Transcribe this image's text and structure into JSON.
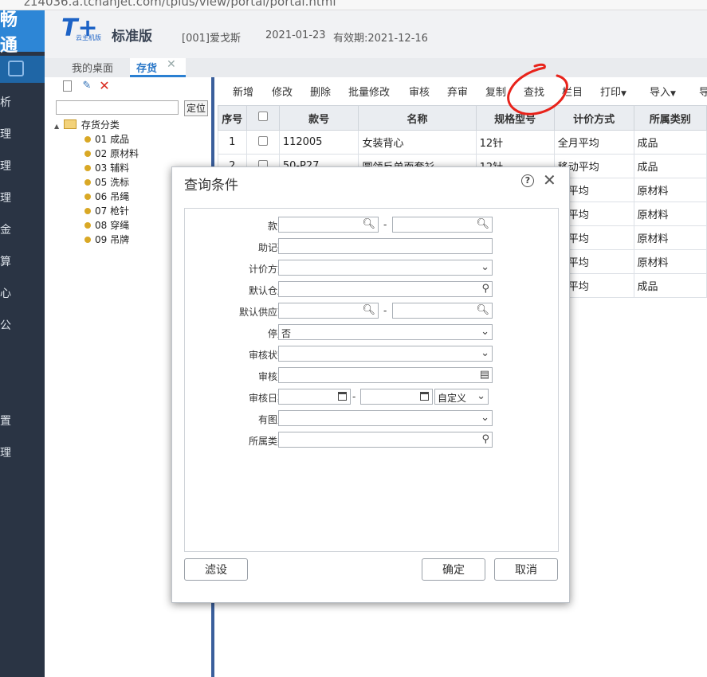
{
  "browser": {
    "url": "z14036.a.tchanjet.com/tplus/view/portal/portal.html"
  },
  "sidebar": {
    "brand": "畅通",
    "items": [
      "析",
      "理",
      "理",
      "理",
      "金",
      "算",
      "心",
      "公",
      "置",
      "理"
    ]
  },
  "header": {
    "logo": "T+",
    "logo_sub": "云主机版",
    "edition": "标准版",
    "company": "[001]爱戈斯",
    "date": "2021-01-23",
    "expiry": "有效期:2021-12-16"
  },
  "tabs": [
    {
      "label": "我的桌面"
    },
    {
      "label": "存货",
      "close": "✕"
    }
  ],
  "tree": {
    "locate_label": "定位",
    "root": "存货分类",
    "nodes": [
      "01 成品",
      "02 原材料",
      "03 辅料",
      "05 洗标",
      "06 吊绳",
      "07 枪针",
      "08 穿绳",
      "09 吊牌"
    ]
  },
  "toolbar": [
    "新增",
    "修改",
    "删除",
    "批量修改",
    "审核",
    "弃审",
    "复制",
    "查找",
    "栏目",
    "打印",
    "导入",
    "导"
  ],
  "grid": {
    "headers": [
      "序号",
      "",
      "款号",
      "名称",
      "规格型号",
      "计价方式",
      "所属类别"
    ],
    "rows": [
      {
        "no": "1",
        "code": "112005",
        "name": "女装背心",
        "spec": "12针",
        "pricing": "全月平均",
        "category": "成品"
      },
      {
        "no": "2",
        "code": "50-P27",
        "name": "圆领反单面套衫",
        "spec": "12针",
        "pricing": "移动平均",
        "category": "成品"
      },
      {
        "no": "",
        "code": "",
        "name": "",
        "spec": "",
        "pricing": "动平均",
        "category": "原材料"
      },
      {
        "no": "",
        "code": "",
        "name": "",
        "spec": "",
        "pricing": "动平均",
        "category": "原材料"
      },
      {
        "no": "",
        "code": "",
        "name": "",
        "spec": "",
        "pricing": "月平均",
        "category": "原材料"
      },
      {
        "no": "",
        "code": "",
        "name": "",
        "spec": "",
        "pricing": "月平均",
        "category": "原材料"
      },
      {
        "no": "",
        "code": "",
        "name": "",
        "spec": "",
        "pricing": "动平均",
        "category": "成品"
      }
    ]
  },
  "annotation_color": "#e8231b",
  "dialog": {
    "title": "查询条件",
    "help": "?",
    "close": "✕",
    "fields": {
      "code": "款号",
      "mnemonic": "助记码",
      "pricing": "计价方式",
      "warehouse": "默认仓库",
      "supplier": "默认供应商",
      "disabled": "停用",
      "disabled_value": "否",
      "audit_status": "审核状态",
      "auditor": "审核人",
      "audit_date": "审核日期",
      "audit_date_mode": "自定义",
      "has_image": "有图片",
      "category": "所属类别"
    },
    "range_sep": "-",
    "buttons": {
      "filter": "滤设",
      "ok": "确定",
      "cancel": "取消"
    }
  }
}
